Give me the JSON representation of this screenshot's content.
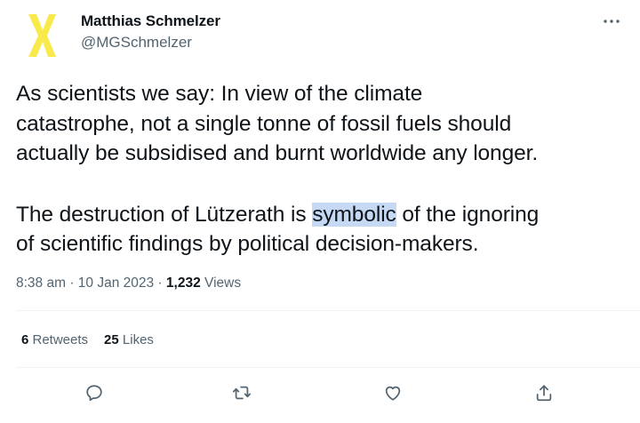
{
  "author": {
    "name": "Matthias Schmelzer",
    "handle": "@MGSchmelzer",
    "avatar_colors": {
      "mark": "#f7ea4a"
    }
  },
  "tweet": {
    "para1": [
      "As scientists we say: In view of the climate",
      "catastrophe, not a single tonne of fossil fuels should",
      "actually be subsidised and burnt worldwide any longer."
    ],
    "para2_line1_before": "The destruction of Lützerath is ",
    "para2_highlight": "symbolic",
    "para2_line1_after": " of the ignoring",
    "para2_line2": "of scientific findings by political decision-makers."
  },
  "meta": {
    "time": "8:38 am",
    "sep1": " · ",
    "date": "10 Jan 2023",
    "sep2": " · ",
    "views_count": "1,232",
    "views_label": " Views"
  },
  "stats": {
    "retweets_count": "6",
    "retweets_label": " Retweets",
    "likes_count": "25",
    "likes_label": " Likes"
  },
  "icons": {
    "more": "more-icon",
    "reply": "reply-icon",
    "retweet": "retweet-icon",
    "like": "like-icon",
    "share": "share-icon"
  },
  "colors": {
    "text_primary": "#0f1419",
    "text_secondary": "#536471",
    "highlight": "#c5d8f4",
    "divider": "#eff3f4"
  }
}
